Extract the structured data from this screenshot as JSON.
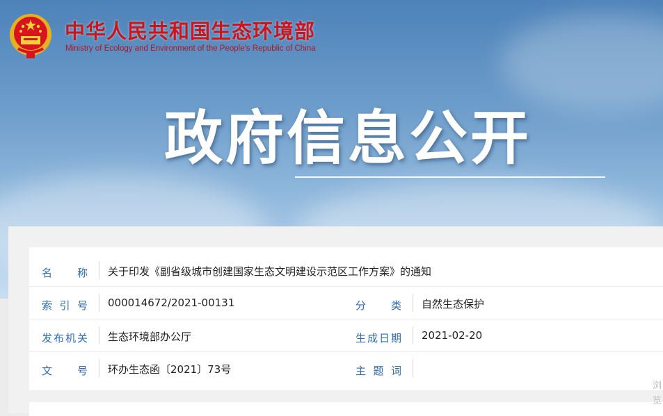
{
  "header": {
    "site_title": "中华人民共和国生态环境部",
    "site_subtitle": "Ministry of Ecology and Environment of the People's Republic of China",
    "hero_title": "政府信息公开"
  },
  "info": {
    "name_label": "名　　称",
    "name_value": "关于印发《副省级城市创建国家生态文明建设示范区工作方案》的通知",
    "index_label": "索 引 号",
    "index_value": "000014672/2021-00131",
    "category_label": "分　　类",
    "category_value": "自然生态保护",
    "publisher_label": "发布机关",
    "publisher_value": "生态环境部办公厅",
    "date_label": "生成日期",
    "date_value": "2021-02-20",
    "doc_no_label": "文　　号",
    "doc_no_value": "环办生态函〔2021〕73号",
    "keywords_label": "主 题 词",
    "keywords_value": ""
  },
  "side": {
    "text": "浏览"
  },
  "colors": {
    "label_blue": "#2d6cb5",
    "brand_red": "#c8161e"
  }
}
